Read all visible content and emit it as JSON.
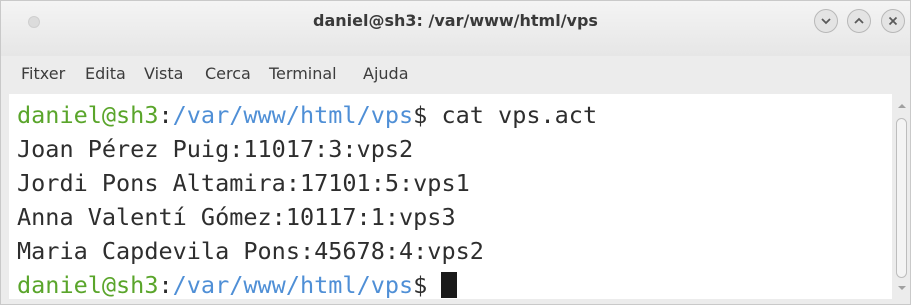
{
  "window": {
    "title": "daniel@sh3: /var/www/html/vps"
  },
  "menu": {
    "items": [
      "Fitxer",
      "Edita",
      "Vista",
      "Cerca",
      "Terminal",
      "Ajuda"
    ]
  },
  "terminal": {
    "prompt_user_host": "daniel@sh3",
    "prompt_sep": ":",
    "prompt_path": "/var/www/html/vps",
    "prompt_symbol": "$ ",
    "command": "cat vps.act",
    "output": [
      "Joan Pérez Puig:11017:3:vps2",
      "Jordi Pons Altamira:17101:5:vps1",
      "Anna Valentí Gómez:10117:1:vps3",
      "Maria Capdevila Pons:45678:4:vps2"
    ]
  },
  "colors": {
    "prompt_user": "#5aa52b",
    "prompt_path": "#4f8fd6",
    "text": "#2e2e2e",
    "background": "#ffffff"
  },
  "icons": [
    "minimize-icon",
    "maximize-icon",
    "close-icon",
    "cursor-block"
  ]
}
